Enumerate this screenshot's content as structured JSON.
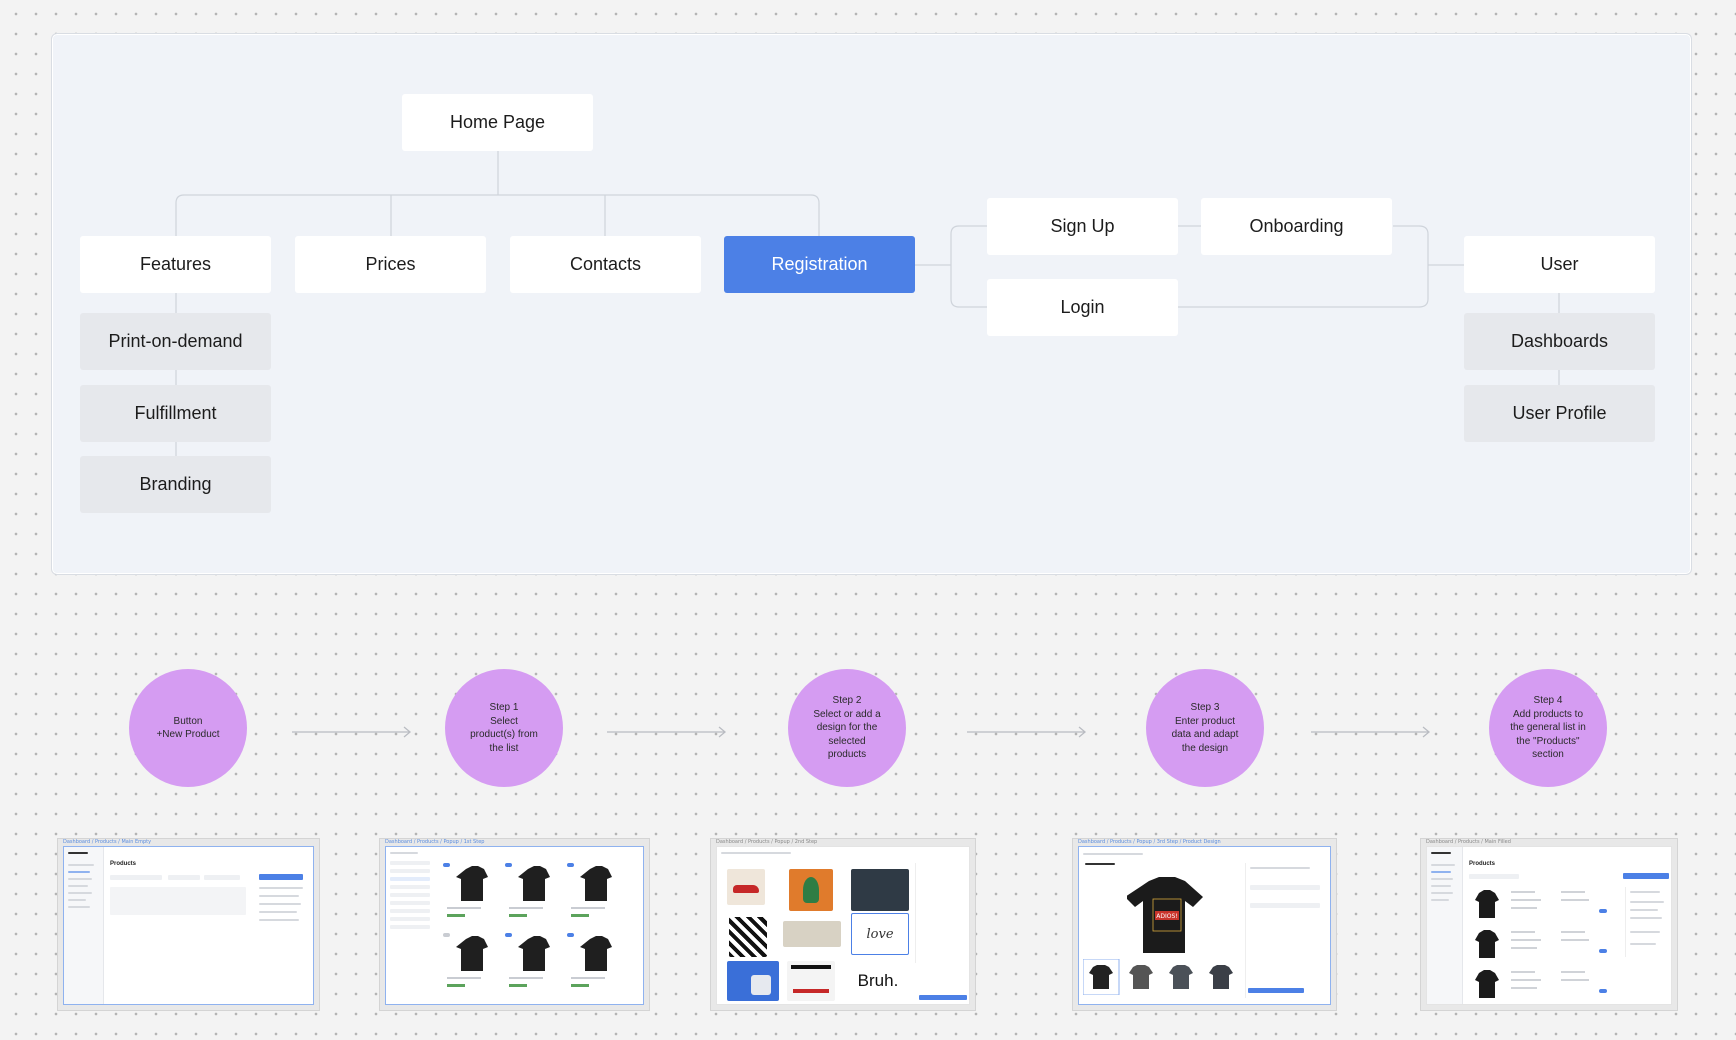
{
  "sitemap": {
    "root": "Home Page",
    "top_level": [
      "Features",
      "Prices",
      "Contacts",
      "Registration"
    ],
    "features_children": [
      "Print-on-demand",
      "Fulfillment",
      "Branding"
    ],
    "auth": {
      "sign_up": "Sign Up",
      "login": "Login",
      "onboarding": "Onboarding"
    },
    "user": {
      "label": "User",
      "children": [
        "Dashboards",
        "User Profile"
      ]
    },
    "highlight_color": "#4c80e6"
  },
  "flow": {
    "steps": [
      "Button\n+New Product",
      "Step 1\nSelect\nproduct(s) from\nthe list",
      "Step 2\nSelect or add a\ndesign for the\nselected\nproducts",
      "Step 3\nEnter product\ndata and adapt\nthe design",
      "Step 4\nAdd products to\nthe general list in\nthe \"Products\"\nsection"
    ],
    "circle_color": "#d59cf2"
  },
  "thumbnails": {
    "paths": [
      "Dashboard / Products / Main Empty",
      "Dashboard / Products / Popup / 1st Step",
      "Dashboard / Products / Popup / 2nd Step",
      "Dashboard / Products / Popup / 3rd Step / Product Design",
      "Dashboard / Products / Main Filled"
    ],
    "page_title": "Products",
    "design_text_bruh": "Bruh.",
    "design_text_love": "love",
    "design_text_adios": "ADIOS!"
  }
}
